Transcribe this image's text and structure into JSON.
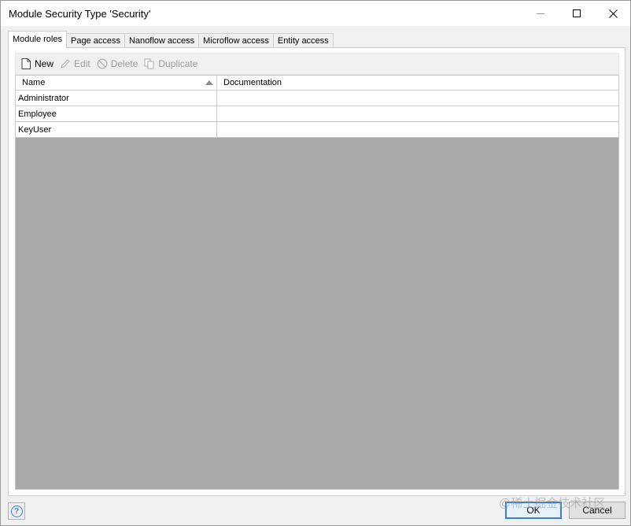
{
  "window": {
    "title": "Module Security Type 'Security'"
  },
  "tabs": [
    {
      "label": "Module roles"
    },
    {
      "label": "Page access"
    },
    {
      "label": "Nanoflow access"
    },
    {
      "label": "Microflow access"
    },
    {
      "label": "Entity access"
    }
  ],
  "toolbar": {
    "new_label": "New",
    "edit_label": "Edit",
    "delete_label": "Delete",
    "duplicate_label": "Duplicate"
  },
  "grid": {
    "columns": [
      "Name",
      "Documentation"
    ],
    "rows": [
      {
        "name": "Administrator",
        "documentation": ""
      },
      {
        "name": "Employee",
        "documentation": ""
      },
      {
        "name": "KeyUser",
        "documentation": ""
      }
    ]
  },
  "footer": {
    "help_glyph": "?",
    "ok_label": "OK",
    "cancel_label": "Cancel"
  },
  "watermark": "@稀土掘金技术社区",
  "colors": {
    "accent": "#3c7fd1",
    "grid_empty": "#a9a9a9",
    "chrome": "#f0f0f0"
  }
}
